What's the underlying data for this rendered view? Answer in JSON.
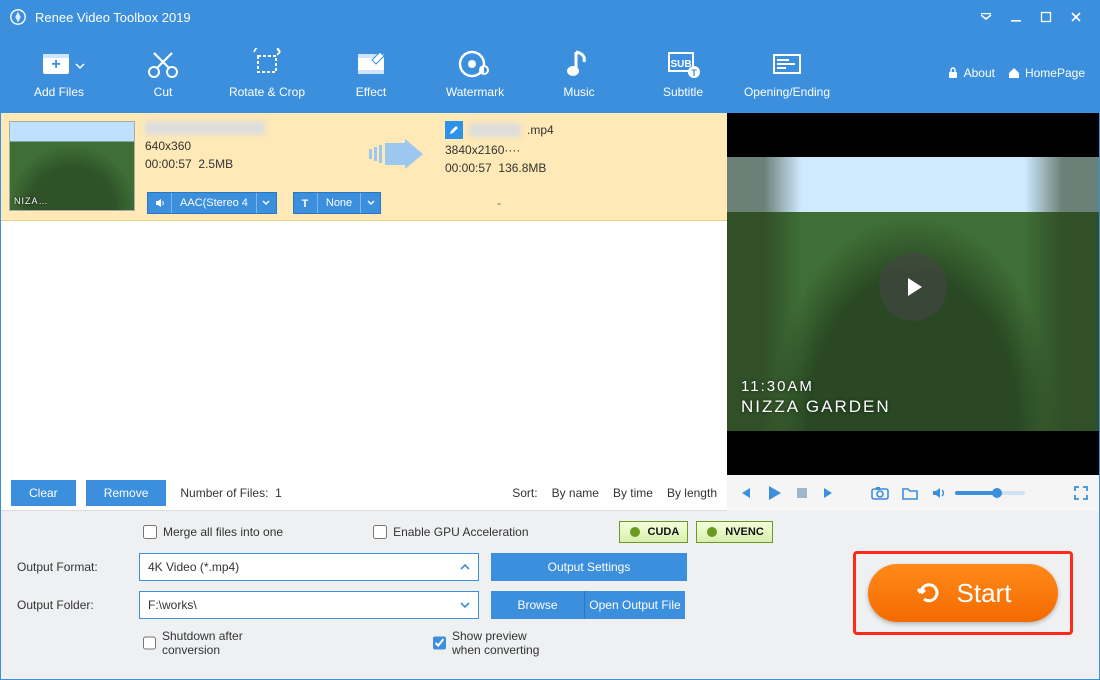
{
  "titlebar": {
    "title": "Renee Video Toolbox 2019"
  },
  "toolbar": {
    "items": [
      {
        "label": "Add Files"
      },
      {
        "label": "Cut"
      },
      {
        "label": "Rotate & Crop"
      },
      {
        "label": "Effect"
      },
      {
        "label": "Watermark"
      },
      {
        "label": "Music"
      },
      {
        "label": "Subtitle"
      },
      {
        "label": "Opening/Ending"
      }
    ],
    "about": "About",
    "home": "HomePage"
  },
  "file": {
    "src": {
      "dim": "640x360",
      "dur": "00:00:57",
      "size": "2.5MB",
      "audio": "AAC(Stereo 4",
      "sub": "None"
    },
    "dst": {
      "ext": ".mp4",
      "dim": "3840x2160····",
      "dur": "00:00:57",
      "size": "136.8MB",
      "eq": "-"
    }
  },
  "listbar": {
    "clear": "Clear",
    "remove": "Remove",
    "count_label": "Number of Files:",
    "count_value": "1",
    "sort_label": "Sort:",
    "sort_opts": [
      "By name",
      "By time",
      "By length"
    ]
  },
  "preview": {
    "overlay_time": "11:30AM",
    "overlay_place": "NIZZA GARDEN"
  },
  "bottom": {
    "merge": "Merge all files into one",
    "gpu": "Enable GPU Acceleration",
    "cuda": "CUDA",
    "nvenc": "NVENC",
    "format_label": "Output Format:",
    "format_value": "4K Video (*.mp4)",
    "output_settings": "Output Settings",
    "folder_label": "Output Folder:",
    "folder_value": "F:\\works\\",
    "browse": "Browse",
    "open_output": "Open Output File",
    "shutdown": "Shutdown after conversion",
    "show_preview": "Show preview when converting",
    "start": "Start"
  }
}
